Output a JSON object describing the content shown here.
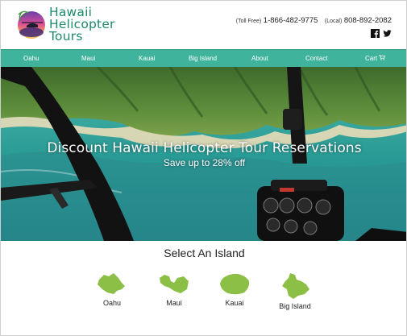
{
  "header": {
    "logo_lines": [
      "Hawaii",
      "Helicopter",
      "Tours"
    ],
    "toll_free_label": "(Toll Free)",
    "toll_free_number": "1-866-482-9775",
    "local_label": "(Local)",
    "local_number": "808-892-2082",
    "social_icons": [
      "facebook-icon",
      "twitter-icon"
    ]
  },
  "nav": {
    "items": [
      {
        "label": "Oahu"
      },
      {
        "label": "Maui"
      },
      {
        "label": "Kauai"
      },
      {
        "label": "Big Island"
      },
      {
        "label": "About"
      },
      {
        "label": "Contact"
      },
      {
        "label": "Cart",
        "icon": "shopping-cart-icon"
      }
    ]
  },
  "hero": {
    "title": "Discount Hawaii Helicopter Tour Reservations",
    "subtitle": "Save up to 28% off"
  },
  "islands": {
    "title": "Select An Island",
    "items": [
      {
        "label": "Oahu"
      },
      {
        "label": "Maui"
      },
      {
        "label": "Kauai"
      },
      {
        "label": "Big Island"
      }
    ]
  },
  "colors": {
    "accent": "#3fb39b",
    "logo_text": "#1e8a6f",
    "island_green": "#8bbf45"
  }
}
